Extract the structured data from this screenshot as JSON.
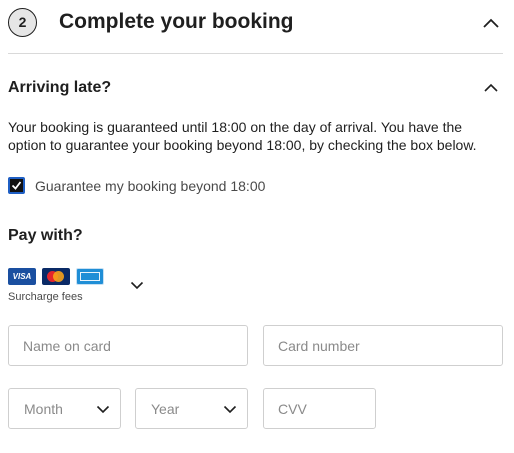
{
  "header": {
    "step_number": "2",
    "title": "Complete your booking"
  },
  "arriving_late": {
    "title": "Arriving late?",
    "description": "Your booking is guaranteed until 18:00 on the day of arrival. You have the option to guarantee your booking beyond 18:00, by checking the box below.",
    "checkbox_label": "Guarantee my booking beyond 18:00",
    "checkbox_checked": true
  },
  "payment": {
    "title": "Pay with?",
    "cards": [
      {
        "name": "visa-card-icon",
        "text": "VISA",
        "color": "#1a4fa0"
      },
      {
        "name": "mastercard-card-icon",
        "color": "#0a2a66"
      },
      {
        "name": "amex-card-icon",
        "color": "#1f8ed6"
      }
    ],
    "surcharge_label": "Surcharge fees",
    "fields": {
      "name_on_card": {
        "placeholder": "Name on card",
        "value": ""
      },
      "card_number": {
        "placeholder": "Card number",
        "value": ""
      },
      "month": {
        "label": "Month"
      },
      "year": {
        "label": "Year"
      },
      "cvv": {
        "placeholder": "CVV",
        "value": ""
      }
    }
  },
  "colors": {
    "checkbox_border": "#1f5fc4",
    "field_border": "#cfcfcf",
    "divider": "#d9d9d9",
    "step_circle_bg": "#e6e6e6"
  }
}
